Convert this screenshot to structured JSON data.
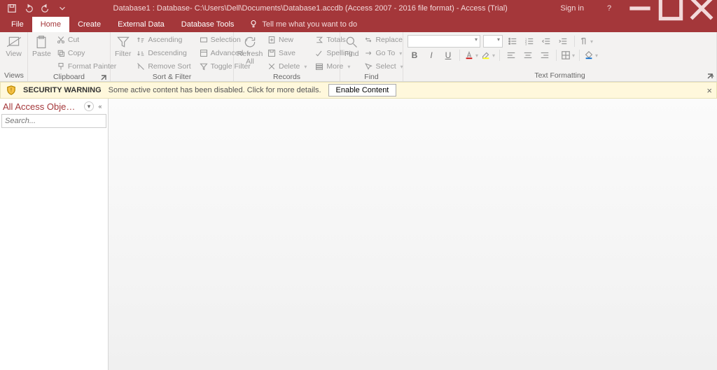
{
  "titlebar": {
    "title": "Database1 : Database- C:\\Users\\Dell\\Documents\\Database1.accdb (Access 2007 - 2016 file format) - Access (Trial)",
    "signin": "Sign in"
  },
  "tabs": {
    "file": "File",
    "home": "Home",
    "create": "Create",
    "external": "External Data",
    "tools": "Database Tools",
    "tellme": "Tell me what you want to do"
  },
  "ribbon": {
    "views": {
      "label": "Views",
      "view": "View"
    },
    "clipboard": {
      "label": "Clipboard",
      "paste": "Paste",
      "cut": "Cut",
      "copy": "Copy",
      "fmt": "Format Painter"
    },
    "sortfilter": {
      "label": "Sort & Filter",
      "filter": "Filter",
      "asc": "Ascending",
      "desc": "Descending",
      "remove": "Remove Sort",
      "selection": "Selection",
      "advanced": "Advanced",
      "toggle": "Toggle Filter"
    },
    "records": {
      "label": "Records",
      "refresh": "Refresh\nAll",
      "new": "New",
      "save": "Save",
      "delete": "Delete",
      "totals": "Totals",
      "spelling": "Spelling",
      "more": "More"
    },
    "find": {
      "label": "Find",
      "find": "Find",
      "replace": "Replace",
      "goto": "Go To",
      "select": "Select"
    },
    "text": {
      "label": "Text Formatting"
    }
  },
  "security": {
    "title": "SECURITY WARNING",
    "msg": "Some active content has been disabled. Click for more details.",
    "btn": "Enable Content"
  },
  "nav": {
    "title": "All Access Obje…",
    "search_placeholder": "Search..."
  }
}
